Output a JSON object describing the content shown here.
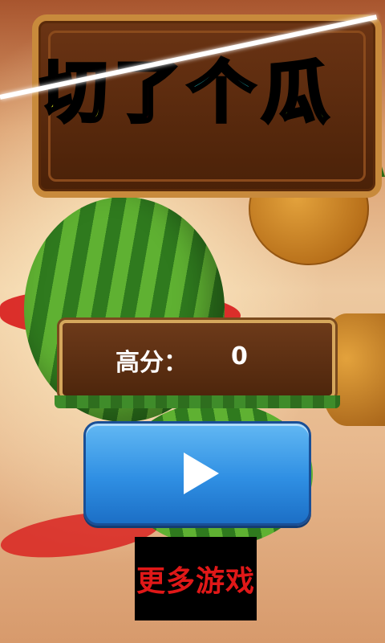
{
  "title": {
    "chars": [
      "切",
      "了",
      "个",
      "瓜"
    ]
  },
  "score": {
    "label": "高分：",
    "value": "0"
  },
  "buttons": {
    "more_label": "更多游戏"
  },
  "colors": {
    "title_1": "#e6ee1e",
    "title_2": "#ee1c1c",
    "title_3": "#1fb6b8",
    "title_4": "#9be21a",
    "play_button": "#2f8fe3",
    "more_text": "#e01818"
  },
  "icons": {
    "play": "play-icon"
  }
}
